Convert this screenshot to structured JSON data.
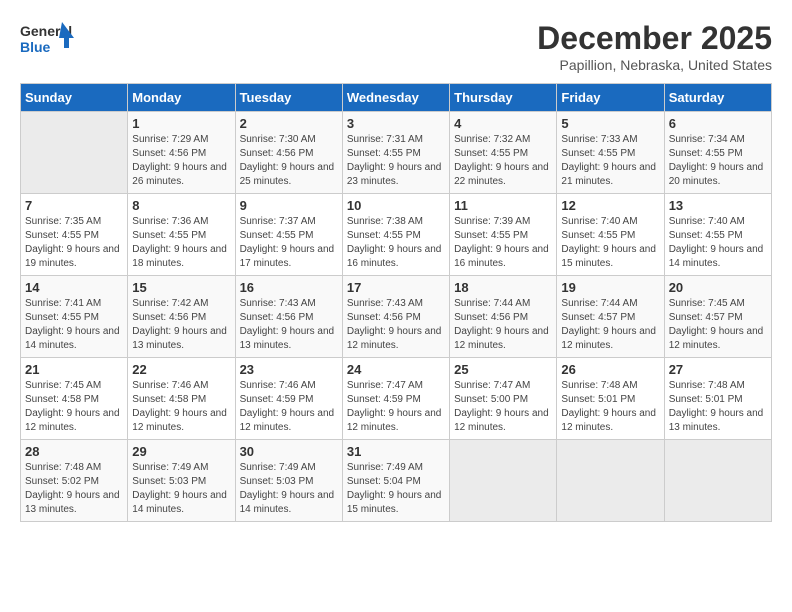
{
  "logo": {
    "line1": "General",
    "line2": "Blue"
  },
  "title": "December 2025",
  "subtitle": "Papillion, Nebraska, United States",
  "days_header": [
    "Sunday",
    "Monday",
    "Tuesday",
    "Wednesday",
    "Thursday",
    "Friday",
    "Saturday"
  ],
  "weeks": [
    [
      {
        "day": "",
        "sunrise": "",
        "sunset": "",
        "daylight": ""
      },
      {
        "day": "1",
        "sunrise": "Sunrise: 7:29 AM",
        "sunset": "Sunset: 4:56 PM",
        "daylight": "Daylight: 9 hours and 26 minutes."
      },
      {
        "day": "2",
        "sunrise": "Sunrise: 7:30 AM",
        "sunset": "Sunset: 4:56 PM",
        "daylight": "Daylight: 9 hours and 25 minutes."
      },
      {
        "day": "3",
        "sunrise": "Sunrise: 7:31 AM",
        "sunset": "Sunset: 4:55 PM",
        "daylight": "Daylight: 9 hours and 23 minutes."
      },
      {
        "day": "4",
        "sunrise": "Sunrise: 7:32 AM",
        "sunset": "Sunset: 4:55 PM",
        "daylight": "Daylight: 9 hours and 22 minutes."
      },
      {
        "day": "5",
        "sunrise": "Sunrise: 7:33 AM",
        "sunset": "Sunset: 4:55 PM",
        "daylight": "Daylight: 9 hours and 21 minutes."
      },
      {
        "day": "6",
        "sunrise": "Sunrise: 7:34 AM",
        "sunset": "Sunset: 4:55 PM",
        "daylight": "Daylight: 9 hours and 20 minutes."
      }
    ],
    [
      {
        "day": "7",
        "sunrise": "Sunrise: 7:35 AM",
        "sunset": "Sunset: 4:55 PM",
        "daylight": "Daylight: 9 hours and 19 minutes."
      },
      {
        "day": "8",
        "sunrise": "Sunrise: 7:36 AM",
        "sunset": "Sunset: 4:55 PM",
        "daylight": "Daylight: 9 hours and 18 minutes."
      },
      {
        "day": "9",
        "sunrise": "Sunrise: 7:37 AM",
        "sunset": "Sunset: 4:55 PM",
        "daylight": "Daylight: 9 hours and 17 minutes."
      },
      {
        "day": "10",
        "sunrise": "Sunrise: 7:38 AM",
        "sunset": "Sunset: 4:55 PM",
        "daylight": "Daylight: 9 hours and 16 minutes."
      },
      {
        "day": "11",
        "sunrise": "Sunrise: 7:39 AM",
        "sunset": "Sunset: 4:55 PM",
        "daylight": "Daylight: 9 hours and 16 minutes."
      },
      {
        "day": "12",
        "sunrise": "Sunrise: 7:40 AM",
        "sunset": "Sunset: 4:55 PM",
        "daylight": "Daylight: 9 hours and 15 minutes."
      },
      {
        "day": "13",
        "sunrise": "Sunrise: 7:40 AM",
        "sunset": "Sunset: 4:55 PM",
        "daylight": "Daylight: 9 hours and 14 minutes."
      }
    ],
    [
      {
        "day": "14",
        "sunrise": "Sunrise: 7:41 AM",
        "sunset": "Sunset: 4:55 PM",
        "daylight": "Daylight: 9 hours and 14 minutes."
      },
      {
        "day": "15",
        "sunrise": "Sunrise: 7:42 AM",
        "sunset": "Sunset: 4:56 PM",
        "daylight": "Daylight: 9 hours and 13 minutes."
      },
      {
        "day": "16",
        "sunrise": "Sunrise: 7:43 AM",
        "sunset": "Sunset: 4:56 PM",
        "daylight": "Daylight: 9 hours and 13 minutes."
      },
      {
        "day": "17",
        "sunrise": "Sunrise: 7:43 AM",
        "sunset": "Sunset: 4:56 PM",
        "daylight": "Daylight: 9 hours and 12 minutes."
      },
      {
        "day": "18",
        "sunrise": "Sunrise: 7:44 AM",
        "sunset": "Sunset: 4:56 PM",
        "daylight": "Daylight: 9 hours and 12 minutes."
      },
      {
        "day": "19",
        "sunrise": "Sunrise: 7:44 AM",
        "sunset": "Sunset: 4:57 PM",
        "daylight": "Daylight: 9 hours and 12 minutes."
      },
      {
        "day": "20",
        "sunrise": "Sunrise: 7:45 AM",
        "sunset": "Sunset: 4:57 PM",
        "daylight": "Daylight: 9 hours and 12 minutes."
      }
    ],
    [
      {
        "day": "21",
        "sunrise": "Sunrise: 7:45 AM",
        "sunset": "Sunset: 4:58 PM",
        "daylight": "Daylight: 9 hours and 12 minutes."
      },
      {
        "day": "22",
        "sunrise": "Sunrise: 7:46 AM",
        "sunset": "Sunset: 4:58 PM",
        "daylight": "Daylight: 9 hours and 12 minutes."
      },
      {
        "day": "23",
        "sunrise": "Sunrise: 7:46 AM",
        "sunset": "Sunset: 4:59 PM",
        "daylight": "Daylight: 9 hours and 12 minutes."
      },
      {
        "day": "24",
        "sunrise": "Sunrise: 7:47 AM",
        "sunset": "Sunset: 4:59 PM",
        "daylight": "Daylight: 9 hours and 12 minutes."
      },
      {
        "day": "25",
        "sunrise": "Sunrise: 7:47 AM",
        "sunset": "Sunset: 5:00 PM",
        "daylight": "Daylight: 9 hours and 12 minutes."
      },
      {
        "day": "26",
        "sunrise": "Sunrise: 7:48 AM",
        "sunset": "Sunset: 5:01 PM",
        "daylight": "Daylight: 9 hours and 12 minutes."
      },
      {
        "day": "27",
        "sunrise": "Sunrise: 7:48 AM",
        "sunset": "Sunset: 5:01 PM",
        "daylight": "Daylight: 9 hours and 13 minutes."
      }
    ],
    [
      {
        "day": "28",
        "sunrise": "Sunrise: 7:48 AM",
        "sunset": "Sunset: 5:02 PM",
        "daylight": "Daylight: 9 hours and 13 minutes."
      },
      {
        "day": "29",
        "sunrise": "Sunrise: 7:49 AM",
        "sunset": "Sunset: 5:03 PM",
        "daylight": "Daylight: 9 hours and 14 minutes."
      },
      {
        "day": "30",
        "sunrise": "Sunrise: 7:49 AM",
        "sunset": "Sunset: 5:03 PM",
        "daylight": "Daylight: 9 hours and 14 minutes."
      },
      {
        "day": "31",
        "sunrise": "Sunrise: 7:49 AM",
        "sunset": "Sunset: 5:04 PM",
        "daylight": "Daylight: 9 hours and 15 minutes."
      },
      {
        "day": "",
        "sunrise": "",
        "sunset": "",
        "daylight": ""
      },
      {
        "day": "",
        "sunrise": "",
        "sunset": "",
        "daylight": ""
      },
      {
        "day": "",
        "sunrise": "",
        "sunset": "",
        "daylight": ""
      }
    ]
  ]
}
